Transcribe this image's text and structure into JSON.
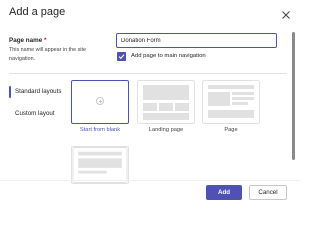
{
  "dialog": {
    "title": "Add a page",
    "close_icon": "close-icon"
  },
  "page_name": {
    "label": "Page name",
    "required_marker": "*",
    "help_text": "This name will appear in the site navigation.",
    "value": "Donation Form"
  },
  "nav_option": {
    "label": "Add page to main navigation",
    "checked": true
  },
  "categories": [
    {
      "label": "Standard layouts",
      "selected": true
    },
    {
      "label": "Custom layout",
      "selected": false
    }
  ],
  "layouts": [
    {
      "label": "Start from blank",
      "selected": true,
      "icon": "add-circle-icon"
    },
    {
      "label": "Landing page",
      "selected": false
    },
    {
      "label": "Page",
      "selected": false
    }
  ],
  "footer": {
    "add_label": "Add",
    "cancel_label": "Cancel"
  },
  "colors": {
    "accent": "#4f52b2",
    "required": "#c50f1f"
  }
}
